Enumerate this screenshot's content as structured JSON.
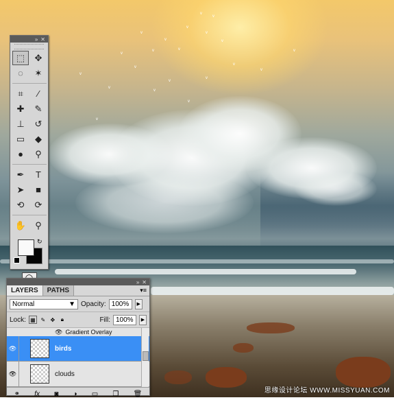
{
  "tools_panel": {
    "title_bar_icons": [
      "collapse-icon",
      "close-icon"
    ],
    "tools": [
      {
        "name": "rectangular-marquee-icon",
        "glyph": "⬚",
        "active": true
      },
      {
        "name": "move-icon",
        "glyph": "✥"
      },
      {
        "name": "lasso-icon",
        "glyph": "◌"
      },
      {
        "name": "magic-wand-icon",
        "glyph": "✶"
      },
      {
        "name": "crop-icon",
        "glyph": "⌗"
      },
      {
        "name": "eyedropper-icon",
        "glyph": "⁄"
      },
      {
        "name": "healing-brush-icon",
        "glyph": "✚"
      },
      {
        "name": "brush-icon",
        "glyph": "✎"
      },
      {
        "name": "clone-stamp-icon",
        "glyph": "⊥"
      },
      {
        "name": "history-brush-icon",
        "glyph": "↺"
      },
      {
        "name": "eraser-icon",
        "glyph": "▭"
      },
      {
        "name": "paint-bucket-icon",
        "glyph": "◆"
      },
      {
        "name": "blur-icon",
        "glyph": "●"
      },
      {
        "name": "dodge-icon",
        "glyph": "⚲"
      },
      {
        "name": "pen-icon",
        "glyph": "✒"
      },
      {
        "name": "type-icon",
        "glyph": "T"
      },
      {
        "name": "path-selection-icon",
        "glyph": "➤"
      },
      {
        "name": "rectangle-shape-icon",
        "glyph": "■"
      },
      {
        "name": "3d-rotate-icon",
        "glyph": "⟲"
      },
      {
        "name": "3d-orbit-icon",
        "glyph": "⟳"
      },
      {
        "name": "hand-icon",
        "glyph": "✋"
      },
      {
        "name": "zoom-icon",
        "glyph": "⚲"
      }
    ],
    "foreground_color": "#fafafa",
    "background_color": "#050505"
  },
  "layers_panel": {
    "tabs": [
      {
        "label": "LAYERS",
        "selected": true
      },
      {
        "label": "PATHS",
        "selected": false
      }
    ],
    "blend_mode": "Normal",
    "opacity_label": "Opacity:",
    "opacity_value": "100%",
    "lock_label": "Lock:",
    "fill_label": "Fill:",
    "fill_value": "100%",
    "effect_label": "Gradient Overlay",
    "layers": [
      {
        "name": "birds",
        "selected": true,
        "visible": true
      },
      {
        "name": "clouds",
        "selected": false,
        "visible": true
      }
    ],
    "footer_icons": [
      "link-layers-icon",
      "fx-icon",
      "add-mask-icon",
      "adjustment-layer-icon",
      "new-group-icon",
      "new-layer-icon",
      "delete-layer-icon"
    ]
  },
  "canvas": {
    "accent_sky": "#f3c86a",
    "accent_sea": "#3d5963",
    "watermark": "思缘设计论坛 WWW.MISSYUAN.COM"
  }
}
